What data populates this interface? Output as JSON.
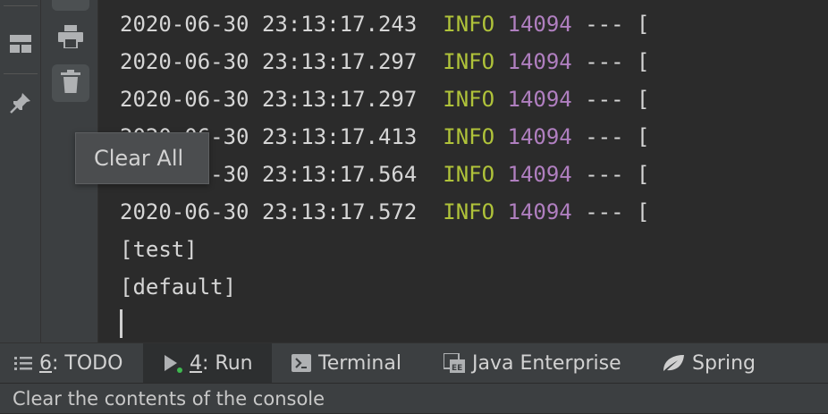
{
  "console": {
    "log_lines": [
      {
        "timestamp": "2020-06-30 23:13:17.243",
        "level": "INFO",
        "pid": "14094",
        "rest": " --- ["
      },
      {
        "timestamp": "2020-06-30 23:13:17.297",
        "level": "INFO",
        "pid": "14094",
        "rest": " --- ["
      },
      {
        "timestamp": "2020-06-30 23:13:17.297",
        "level": "INFO",
        "pid": "14094",
        "rest": " --- ["
      },
      {
        "timestamp": "2020-06-30 23:13:17.413",
        "level": "INFO",
        "pid": "14094",
        "rest": " --- ["
      },
      {
        "timestamp": "2020-06-30 23:13:17.564",
        "level": "INFO",
        "pid": "14094",
        "rest": " --- ["
      },
      {
        "timestamp": "2020-06-30 23:13:17.572",
        "level": "INFO",
        "pid": "14094",
        "rest": " --- ["
      }
    ],
    "plain_lines": [
      "[test]",
      "[default]"
    ]
  },
  "tooltip": {
    "text": "Clear All"
  },
  "left_strip": {
    "icons": [
      "layout-icon",
      "pin-icon"
    ]
  },
  "tool_strip": {
    "icons": [
      "print-icon",
      "trash-icon"
    ]
  },
  "tool_window_tabs": [
    {
      "mnemonic": "6",
      "label": ": TODO",
      "icon": "list-icon",
      "active": false
    },
    {
      "mnemonic": "4",
      "label": ": Run",
      "icon": "run-icon",
      "active": true
    },
    {
      "label": "Terminal",
      "icon": "terminal-icon",
      "active": false
    },
    {
      "label": "Java Enterprise",
      "icon": "java-enterprise-icon",
      "active": false
    },
    {
      "label": "Spring",
      "icon": "spring-icon",
      "active": false
    }
  ],
  "status_bar": {
    "text": "Clear the contents of the console"
  },
  "colors": {
    "background": "#2b2b2b",
    "panel": "#3c3f41",
    "info_level": "#b0c33a",
    "pid": "#b07fc0",
    "run_dot": "#3fb950",
    "spring_leaf": "#cfcfcf"
  }
}
